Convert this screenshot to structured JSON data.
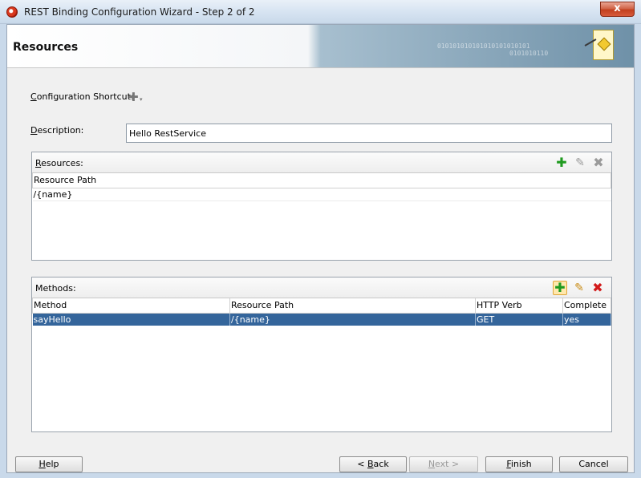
{
  "window": {
    "title": "REST Binding Configuration Wizard - Step 2 of 2",
    "close_glyph": "x"
  },
  "banner": {
    "title": "Resources",
    "binary_lines": [
      "010101010101010101010101",
      "0101010110"
    ]
  },
  "form": {
    "shortcut_label": "Configuration Shortcut:",
    "shortcut_icon": "✚",
    "shortcut_caret": "▾",
    "description_label": "Description:",
    "description_value": "Hello RestService"
  },
  "resources": {
    "title": "Resources:",
    "add_icon": "✚",
    "edit_icon": "✎",
    "delete_icon": "✖",
    "columns": [
      "Resource Path"
    ],
    "rows": [
      [
        "/{name}"
      ]
    ]
  },
  "methods": {
    "title": "Methods:",
    "add_icon": "✚",
    "edit_icon": "✎",
    "delete_icon": "✖",
    "columns": [
      "Method",
      "Resource Path",
      "HTTP Verb",
      "Complete"
    ],
    "rows": [
      [
        "sayHello",
        "/{name}",
        "GET",
        "yes"
      ]
    ]
  },
  "buttons": {
    "help": "Help",
    "back": "< Back",
    "next": "Next >",
    "finish": "Finish",
    "cancel": "Cancel"
  },
  "colors": {
    "selection": "#34659b",
    "add_green": "#1f9a1f",
    "delete_red": "#d21a1a"
  }
}
